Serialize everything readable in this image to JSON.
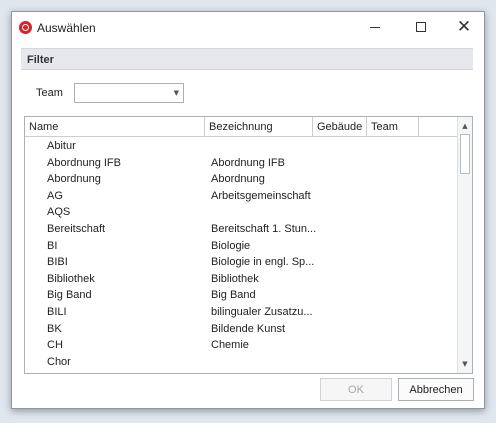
{
  "window": {
    "title": "Auswählen"
  },
  "filter": {
    "header": "Filter",
    "team_label": "Team",
    "team_value": ""
  },
  "grid": {
    "columns": [
      "Name",
      "Bezeichnung",
      "Gebäude",
      "Team"
    ],
    "rows": [
      {
        "name": "Abitur",
        "bezeichnung": ""
      },
      {
        "name": "Abordnung IFB",
        "bezeichnung": "Abordnung IFB"
      },
      {
        "name": "Abordnung",
        "bezeichnung": "Abordnung"
      },
      {
        "name": "AG",
        "bezeichnung": "Arbeitsgemeinschaft"
      },
      {
        "name": "AQS",
        "bezeichnung": ""
      },
      {
        "name": "Bereitschaft",
        "bezeichnung": "Bereitschaft 1. Stun..."
      },
      {
        "name": "BI",
        "bezeichnung": "Biologie"
      },
      {
        "name": "BIBI",
        "bezeichnung": "Biologie in engl. Sp..."
      },
      {
        "name": "Bibliothek",
        "bezeichnung": "Bibliothek"
      },
      {
        "name": "Big Band",
        "bezeichnung": "Big Band"
      },
      {
        "name": "BILI",
        "bezeichnung": "bilingualer Zusatzu..."
      },
      {
        "name": "BK",
        "bezeichnung": "Bildende Kunst"
      },
      {
        "name": "CH",
        "bezeichnung": "Chemie"
      },
      {
        "name": "Chor",
        "bezeichnung": ""
      }
    ]
  },
  "buttons": {
    "ok": "OK",
    "cancel": "Abbrechen"
  },
  "icons": {
    "app": "app-logo-icon",
    "minimize": "minimize-icon",
    "maximize": "maximize-icon",
    "close": "close-icon",
    "dropdown": "chevron-down-icon",
    "scroll_up": "scroll-up-arrow-icon",
    "scroll_down": "scroll-down-arrow-icon"
  },
  "colors": {
    "accent": "#d8232a",
    "filter_header_bg": "#e6e8ec",
    "disabled_text": "#a8a8a8"
  }
}
